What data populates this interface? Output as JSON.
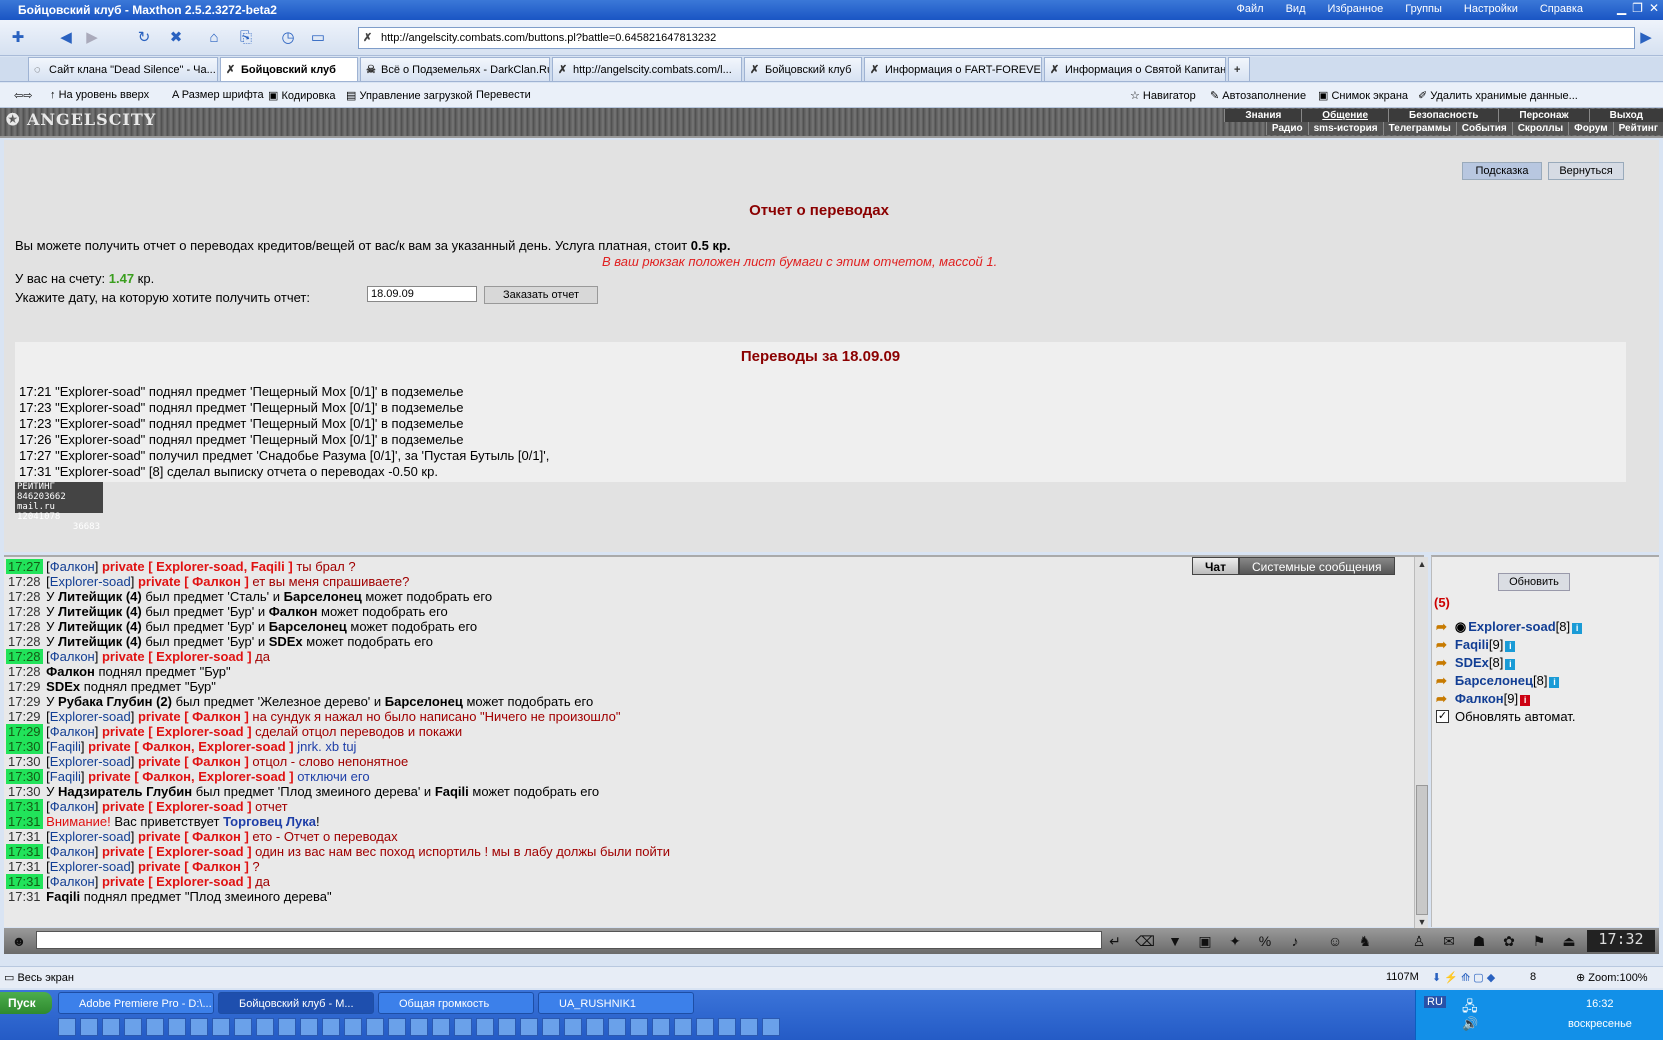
{
  "window": {
    "title": "Бойцовский клуб - Maxthon 2.5.2.3272-beta2",
    "menus": [
      "Файл",
      "Вид",
      "Избранное",
      "Группы",
      "Настройки",
      "Справка"
    ]
  },
  "browser": {
    "url": "http://angelscity.combats.com/buttons.pl?battle=0.645821647813232",
    "tabs": [
      "Сайт клана \"Dead Silence\" - Ча...",
      "Бойцовский клуб",
      "Всё о Подземельях - DarkClan.Ru",
      "http://angelscity.combats.com/l...",
      "Бойцовский клуб",
      "Информация о FART-FOREVER",
      "Информация о Святой Капитан"
    ],
    "toolbar2": [
      "На уровень вверх",
      "Размер шрифта",
      "Кодировка",
      "Управление загрузкой",
      "Перевести"
    ],
    "toolbar2_right": [
      "Навигатор",
      "Автозаполнение",
      "Снимок экрана",
      "Удалить хранимые данные..."
    ]
  },
  "game": {
    "logo": "ANGELSCITY",
    "nav1": [
      "Знания",
      "Общение",
      "Безопасность",
      "Персонаж",
      "Выход"
    ],
    "nav2": [
      "Радио",
      "sms-история",
      "Телеграммы",
      "События",
      "Скроллы",
      "Форум",
      "Рейтинг"
    ]
  },
  "report": {
    "hint_btn": "Подсказка",
    "back_btn": "Вернуться",
    "title": "Отчет о переводах",
    "desc": "Вы можете получить отчет о переводах кредитов/вещей от вас/к вам за указанный день. Услуга платная, стоит ",
    "price": "0.5 кр.",
    "note": "В ваш рюкзак положен лист бумаги с этим отчетом, массой 1.",
    "balance_label": "У вас на счету: ",
    "balance": "1.47",
    "balance_unit": " кр.",
    "date_label": "Укажите дату, на которую хотите получить отчет:",
    "date_value": "18.09.09",
    "order_btn": "Заказать отчет",
    "list_title": "Переводы за 18.09.09",
    "lines": [
      "17:21 \"Explorer-soad\" поднял предмет 'Пещерный Мох [0/1]' в подземелье",
      "17:23 \"Explorer-soad\" поднял предмет 'Пещерный Мох [0/1]' в подземелье",
      "17:23 \"Explorer-soad\" поднял предмет 'Пещерный Мох [0/1]' в подземелье",
      "17:26 \"Explorer-soad\" поднял предмет 'Пещерный Мох [0/1]' в подземелье",
      "17:27 \"Explorer-soad\" получил предмет 'Снадобье Разума [0/1]', за 'Пустая Бутыль [0/1]',",
      "17:31 \"Explorer-soad\" [8] сделал выписку отчета о переводах -0.50 кр."
    ],
    "counter": [
      "РЕЙТИНГ 846203662",
      "mail.ru 12041078",
      "36683"
    ]
  },
  "chat": {
    "tabs": [
      "Чат",
      "Системные сообщения"
    ],
    "lines": [
      {
        "t": "17:27",
        "g": true,
        "n": "Фалкон",
        "p": "private [ Explorer-soad, Faqili ]",
        "m": " ты брал ?"
      },
      {
        "t": "17:28",
        "g": false,
        "n": "Explorer-soad",
        "p": "private [ Фалкон ]",
        "m": " ет вы меня спрашиваете?"
      },
      {
        "t": "17:28",
        "g": false,
        "sys": "У |Литейщик (4)| был предмет 'Сталь' и |Барселонец| может подобрать его"
      },
      {
        "t": "17:28",
        "g": false,
        "sys": "У |Литейщик (4)| был предмет 'Бур' и |Фалкон| может подобрать его"
      },
      {
        "t": "17:28",
        "g": false,
        "sys": "У |Литейщик (4)| был предмет 'Бур' и |Барселонец| может подобрать его"
      },
      {
        "t": "17:28",
        "g": false,
        "sys": "У |Литейщик (4)| был предмет 'Бур' и |SDEx| может подобрать его"
      },
      {
        "t": "17:28",
        "g": true,
        "n": "Фалкон",
        "p": "private [ Explorer-soad ]",
        "m": " да"
      },
      {
        "t": "17:28",
        "g": false,
        "sys": "|Фалкон| поднял предмет \"Бур\""
      },
      {
        "t": "17:29",
        "g": false,
        "sys": "|SDEx| поднял предмет \"Бур\""
      },
      {
        "t": "17:29",
        "g": false,
        "sys": "У |Рубака Глубин (2)| был предмет 'Железное дерево' и |Барселонец| может подобрать его"
      },
      {
        "t": "17:29",
        "g": false,
        "n": "Explorer-soad",
        "p": "private [ Фалкон ]",
        "m": " на сундук я нажал но было написано \"Ничего не произошло\""
      },
      {
        "t": "17:29",
        "g": true,
        "n": "Фалкон",
        "p": "private [ Explorer-soad ]",
        "m": " сделай отцол переводов и покажи"
      },
      {
        "t": "17:30",
        "g": true,
        "n": "Faqili",
        "p": "private [ Фалкон, Explorer-soad ]",
        "m": " jnrk. xb tuj",
        "mb": true
      },
      {
        "t": "17:30",
        "g": false,
        "n": "Explorer-soad",
        "p": "private [ Фалкон ]",
        "m": " отцол - слово непонятное"
      },
      {
        "t": "17:30",
        "g": true,
        "n": "Faqili",
        "p": "private [ Фалкон, Explorer-soad ]",
        "m": " отключи его",
        "mb": true
      },
      {
        "t": "17:30",
        "g": false,
        "sys": "У |Надзиратель Глубин| был предмет 'Плод змеиного дерева' и |Faqili| может подобрать его"
      },
      {
        "t": "17:31",
        "g": true,
        "n": "Фалкон",
        "p": "private [ Explorer-soad ]",
        "m": " отчет"
      },
      {
        "t": "17:31",
        "g": true,
        "warn": "Внимание!",
        "wm": " Вас приветствует ",
        "wn": "Торговец Лука",
        "we": "!"
      },
      {
        "t": "17:31",
        "g": false,
        "n": "Explorer-soad",
        "p": "private [ Фалкон ]",
        "m": " ето - Отчет о переводах"
      },
      {
        "t": "17:31",
        "g": true,
        "n": "Фалкон",
        "p": "private [ Explorer-soad ]",
        "m": " один из вас нам вес поход испортиль ! мы в лабу должы были пойти"
      },
      {
        "t": "17:31",
        "g": false,
        "n": "Explorer-soad",
        "p": "private [ Фалкон ]",
        "m": " ?"
      },
      {
        "t": "17:31",
        "g": true,
        "n": "Фалкон",
        "p": "private [ Explorer-soad ]",
        "m": " да"
      },
      {
        "t": "17:31",
        "g": false,
        "sys": "|Faqili| поднял предмет \"Плод змеиного дерева\""
      }
    ]
  },
  "users": {
    "refresh": "Обновить",
    "count": "(5)",
    "list": [
      {
        "name": "Explorer-soad",
        "level": "[8]",
        "info": "i"
      },
      {
        "name": "Faqili",
        "level": "[9]",
        "info": "i"
      },
      {
        "name": "SDEx",
        "level": "[8]",
        "info": "i"
      },
      {
        "name": "Барселонец",
        "level": "[8]",
        "info": "i"
      },
      {
        "name": "Фалкон",
        "level": "[9]",
        "info": "i"
      }
    ],
    "auto": "Обновлять автомат."
  },
  "clock": "17:32",
  "status": {
    "left": "Весь экран",
    "mem": "1107M",
    "tabs_count": "8",
    "zoom": "Zoom:100%"
  },
  "taskbar": {
    "start": "Пуск",
    "tasks": [
      "Adobe Premiere Pro - D:\\...",
      "Бойцовский клуб - M...",
      "Общая громкость",
      "UA_RUSHNIK1"
    ],
    "lang": "RU",
    "time": "16:32",
    "day": "воскресенье"
  }
}
